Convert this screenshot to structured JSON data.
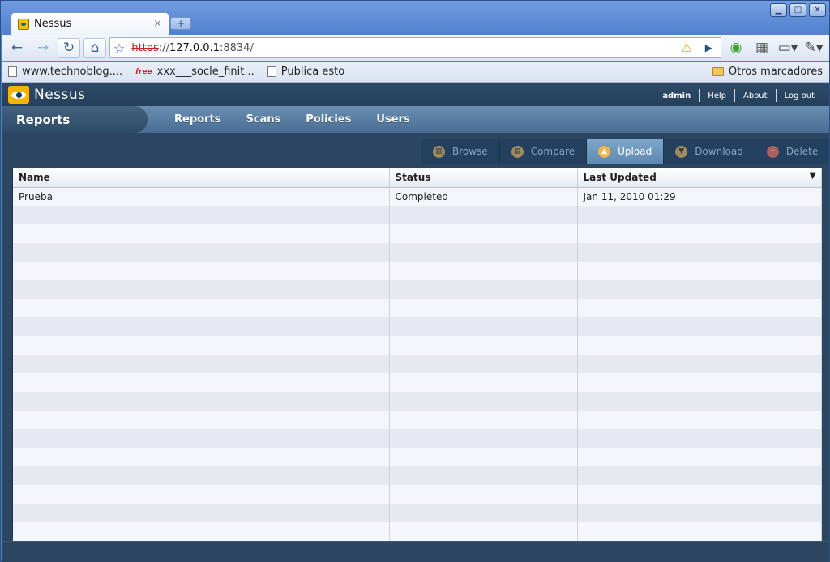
{
  "browser": {
    "tab_title": "Nessus",
    "tab_close": "×",
    "new_tab": "+",
    "url_protocol": "https",
    "url_host": "127.0.0.1",
    "url_rest": ":8834/",
    "bookmarks": [
      "www.technoblog....",
      "xxx___socle_finit...",
      "Publica esto"
    ],
    "bookmark_free_badge": "free",
    "other_bookmarks": "Otros marcadores"
  },
  "app": {
    "logo_text": "Nessus",
    "user": "admin",
    "links": [
      "Help",
      "About",
      "Log out"
    ],
    "section_title": "Reports",
    "nav": [
      "Reports",
      "Scans",
      "Policies",
      "Users"
    ],
    "actions": [
      {
        "label": "Browse",
        "icon": "browse-icon",
        "active": false
      },
      {
        "label": "Compare",
        "icon": "compare-icon",
        "active": false
      },
      {
        "label": "Upload",
        "icon": "upload-icon",
        "active": true
      },
      {
        "label": "Download",
        "icon": "download-icon",
        "active": false
      },
      {
        "label": "Delete",
        "icon": "delete-icon",
        "active": false
      }
    ]
  },
  "table": {
    "columns": [
      "Name",
      "Status",
      "Last Updated"
    ],
    "sort_indicator": "▼",
    "rows": [
      [
        "Prueba",
        "Completed",
        "Jan 11, 2010 01:29"
      ]
    ],
    "empty_rows": 18
  },
  "colors": {
    "accent": "#f1b64a",
    "header_bg": "#2c4560",
    "nav_bg": "#5a7fa3"
  }
}
